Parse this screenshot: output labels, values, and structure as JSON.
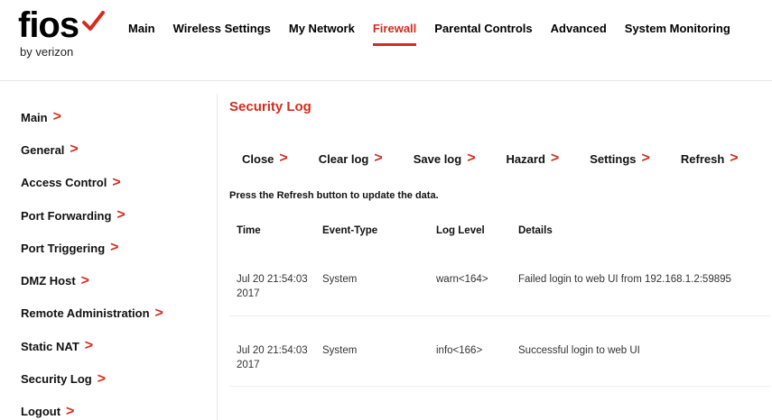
{
  "brand": {
    "name": "fios",
    "sub": "by verizon",
    "check_color": "#d52b1e"
  },
  "topnav": [
    {
      "label": "Main",
      "active": false
    },
    {
      "label": "Wireless Settings",
      "active": false
    },
    {
      "label": "My Network",
      "active": false
    },
    {
      "label": "Firewall",
      "active": true
    },
    {
      "label": "Parental Controls",
      "active": false
    },
    {
      "label": "Advanced",
      "active": false
    },
    {
      "label": "System Monitoring",
      "active": false
    }
  ],
  "sidebar": [
    {
      "label": "Main",
      "chevron": ">"
    },
    {
      "label": "General",
      "chevron": ">"
    },
    {
      "label": "Access Control",
      "chevron": ">"
    },
    {
      "label": "Port Forwarding",
      "chevron": ">"
    },
    {
      "label": "Port Triggering",
      "chevron": ">"
    },
    {
      "label": "DMZ Host",
      "chevron": ">"
    },
    {
      "label": "Remote Administration",
      "chevron": ">"
    },
    {
      "label": "Static NAT",
      "chevron": ">"
    },
    {
      "label": "Security Log",
      "chevron": ">"
    },
    {
      "label": "Logout",
      "chevron": ">"
    }
  ],
  "main": {
    "title": "Security Log",
    "toolbar": [
      {
        "label": "Close",
        "chevron": ">"
      },
      {
        "label": "Clear log",
        "chevron": ">"
      },
      {
        "label": "Save log",
        "chevron": ">"
      },
      {
        "label": "Hazard",
        "chevron": ">"
      },
      {
        "label": "Settings",
        "chevron": ">"
      },
      {
        "label": "Refresh",
        "chevron": ">"
      }
    ],
    "hint": "Press the Refresh button to update the data.",
    "table": {
      "headers": [
        "Time",
        "Event-Type",
        "Log Level",
        "Details"
      ],
      "rows": [
        {
          "time_line1": "Jul 20 21:54:03",
          "time_line2": "2017",
          "event_type": "System",
          "log_level": "warn<164>",
          "details": "Failed login to web UI from 192.168.1.2:59895"
        },
        {
          "time_line1": "Jul 20 21:54:03",
          "time_line2": "2017",
          "event_type": "System",
          "log_level": "info<166>",
          "details": "Successful login to web UI"
        }
      ]
    }
  },
  "colors": {
    "accent": "#d52b1e",
    "text": "#111111"
  }
}
